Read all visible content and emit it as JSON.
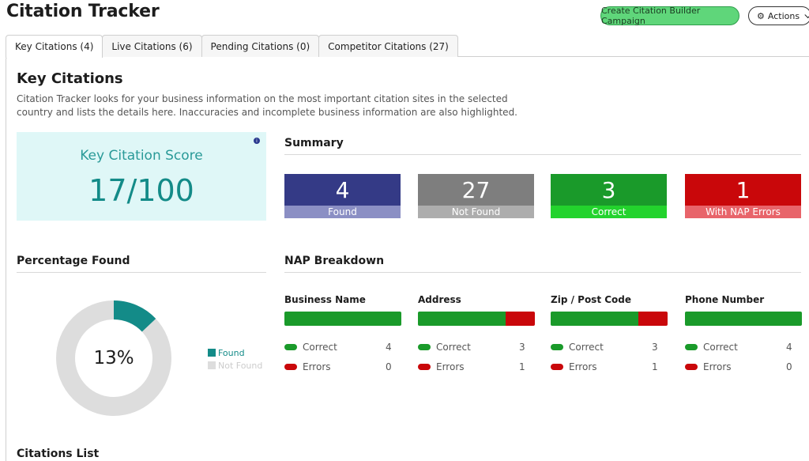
{
  "header": {
    "title": "Citation Tracker",
    "campaign_button": "Create Citation Builder Campaign",
    "actions_button": "Actions",
    "actions_icon": "gear-icon"
  },
  "tabs": [
    {
      "label": "Key Citations (4)",
      "active": true
    },
    {
      "label": "Live Citations (6)",
      "active": false
    },
    {
      "label": "Pending Citations (0)",
      "active": false
    },
    {
      "label": "Competitor Citations (27)",
      "active": false
    }
  ],
  "section": {
    "title": "Key Citations",
    "description": "Citation Tracker looks for your business information on the most important citation sites in the selected country and lists the details here. Inaccuracies and incomplete business information are also highlighted."
  },
  "score": {
    "label": "Key Citation Score",
    "value": "17/100",
    "info_icon": "info-icon"
  },
  "summary": {
    "title": "Summary",
    "cards": [
      {
        "value": "4",
        "label": "Found",
        "color": "#343a86",
        "label_color": "#8b8fc4"
      },
      {
        "value": "27",
        "label": "Not Found",
        "color": "#7e7e7e",
        "label_color": "#adadad"
      },
      {
        "value": "3",
        "label": "Correct",
        "color": "#1a9a2a",
        "label_color": "#23d32d"
      },
      {
        "value": "1",
        "label": "With NAP Errors",
        "color": "#c9070a",
        "label_color": "#e8646a"
      }
    ]
  },
  "percentage": {
    "title": "Percentage Found",
    "value_label": "13%",
    "found_fraction": 0.13,
    "found_color": "#138b88",
    "not_found_color": "#dddddd",
    "legend": [
      {
        "label": "Found",
        "color": "#138b88",
        "text_color": "#138b88"
      },
      {
        "label": "Not Found",
        "color": "#dddddd",
        "text_color": "#cccccc"
      }
    ]
  },
  "nap": {
    "title": "NAP Breakdown",
    "correct_label": "Correct",
    "errors_label": "Errors",
    "correct_color": "#1a9a2a",
    "error_color": "#c9070a",
    "columns": [
      {
        "name": "Business Name",
        "correct": "4",
        "errors": "0",
        "correct_fraction": 1.0
      },
      {
        "name": "Address",
        "correct": "3",
        "errors": "1",
        "correct_fraction": 0.75
      },
      {
        "name": "Zip / Post Code",
        "correct": "3",
        "errors": "1",
        "correct_fraction": 0.75
      },
      {
        "name": "Phone Number",
        "correct": "4",
        "errors": "0",
        "correct_fraction": 1.0
      }
    ]
  },
  "citations_list": {
    "title": "Citations List"
  }
}
